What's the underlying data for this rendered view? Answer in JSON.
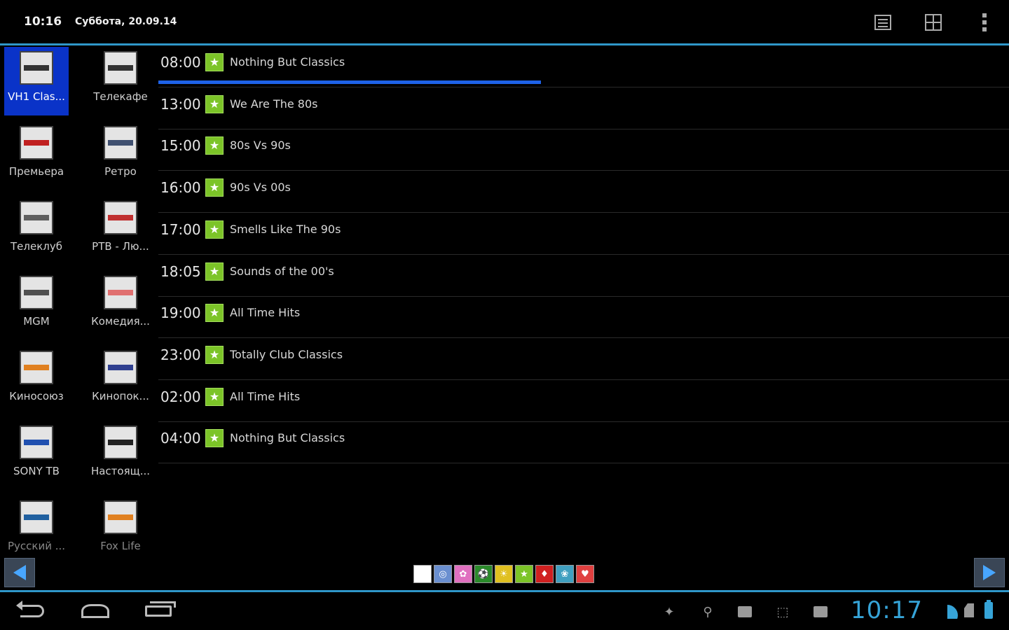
{
  "actionbar": {
    "time": "10:16",
    "date": "Суббота, 20.09.14",
    "icons": [
      "list-view-icon",
      "grid-view-icon",
      "overflow-menu-icon"
    ]
  },
  "channels": [
    {
      "name": "VH1 Clas...",
      "selected": true,
      "stripe": "#333333"
    },
    {
      "name": "Телекафе",
      "selected": false,
      "stripe": "#333333"
    },
    {
      "name": "Премьера",
      "selected": false,
      "stripe": "#c02020"
    },
    {
      "name": "Ретро",
      "selected": false,
      "stripe": "#405070"
    },
    {
      "name": "Телеклуб",
      "selected": false,
      "stripe": "#606060"
    },
    {
      "name": "РТВ - Лю...",
      "selected": false,
      "stripe": "#c03030"
    },
    {
      "name": "MGM",
      "selected": false,
      "stripe": "#505050"
    },
    {
      "name": "Комедия...",
      "selected": false,
      "stripe": "#e07070"
    },
    {
      "name": "Киносоюз",
      "selected": false,
      "stripe": "#e08020"
    },
    {
      "name": "Кинопок...",
      "selected": false,
      "stripe": "#304090"
    },
    {
      "name": "SONY ТВ",
      "selected": false,
      "stripe": "#2050b0"
    },
    {
      "name": "Настоящ...",
      "selected": false,
      "stripe": "#222222"
    },
    {
      "name": "Русский ...",
      "selected": false,
      "stripe": "#2060a0"
    },
    {
      "name": "Fox Life",
      "selected": false,
      "stripe": "#e08020"
    }
  ],
  "programs": [
    {
      "time": "08:00",
      "title": "Nothing But Classics",
      "progress": 0.45
    },
    {
      "time": "13:00",
      "title": "We Are The 80s"
    },
    {
      "time": "15:00",
      "title": "80s Vs 90s"
    },
    {
      "time": "16:00",
      "title": "90s Vs 00s"
    },
    {
      "time": "17:00",
      "title": "Smells Like The 90s"
    },
    {
      "time": "18:05",
      "title": "Sounds of the 00's"
    },
    {
      "time": "19:00",
      "title": "All Time Hits"
    },
    {
      "time": "23:00",
      "title": "Totally Club Classics"
    },
    {
      "time": "02:00",
      "title": "All Time Hits"
    },
    {
      "time": "04:00",
      "title": "Nothing But Classics"
    }
  ],
  "category_icon": "star-icon",
  "category_color": "#7cc428",
  "progress_color": "#1e62e8",
  "accent_color": "#2f97c9",
  "filters": [
    {
      "icon": "blank-filter-icon",
      "color": "#ffffff"
    },
    {
      "icon": "globe-filter-icon",
      "color": "#6a8fd0"
    },
    {
      "icon": "pink-filter-icon",
      "color": "#e070c0"
    },
    {
      "icon": "sport-filter-icon",
      "color": "#2a8a2a"
    },
    {
      "icon": "yellow-filter-icon",
      "color": "#e0c020"
    },
    {
      "icon": "star-filter-icon",
      "color": "#7cc428"
    },
    {
      "icon": "red-filter-icon",
      "color": "#d02020"
    },
    {
      "icon": "nature-filter-icon",
      "color": "#40a0c0"
    },
    {
      "icon": "heart-filter-icon",
      "color": "#e04040"
    }
  ],
  "system": {
    "clock": "10:17"
  }
}
